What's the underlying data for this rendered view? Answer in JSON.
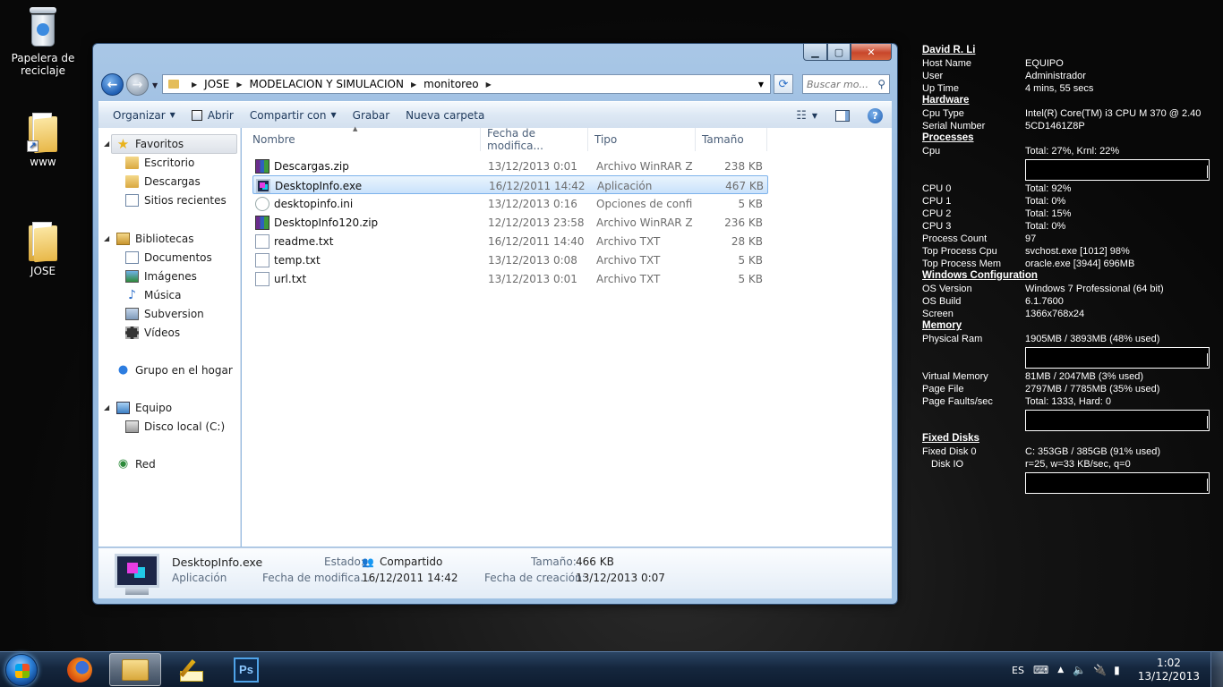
{
  "desktop": {
    "icons": [
      {
        "label": "Papelera de reciclaje",
        "icon": "recycle-bin-icon"
      },
      {
        "label": "www",
        "icon": "folder-shortcut-icon"
      },
      {
        "label": "JOSE",
        "icon": "folder-icon"
      }
    ]
  },
  "window": {
    "controls": {
      "minimize": "▁",
      "maximize": "▢",
      "close": "✕"
    },
    "breadcrumb": [
      "JOSE",
      "MODELACION Y SIMULACION",
      "monitoreo"
    ],
    "search_placeholder": "Buscar mo...",
    "toolbar": {
      "organize": "Organizar",
      "open": "Abrir",
      "share": "Compartir con",
      "burn": "Grabar",
      "new_folder": "Nueva carpeta"
    },
    "nav": {
      "favorites": "Favoritos",
      "desktop": "Escritorio",
      "downloads": "Descargas",
      "recent": "Sitios recientes",
      "libraries": "Bibliotecas",
      "documents": "Documentos",
      "images": "Imágenes",
      "music": "Música",
      "subversion": "Subversion",
      "videos": "Vídeos",
      "homegroup": "Grupo en el hogar",
      "computer": "Equipo",
      "local_disk": "Disco local (C:)",
      "network": "Red"
    },
    "columns": {
      "name": "Nombre",
      "date": "Fecha de modifica...",
      "type": "Tipo",
      "size": "Tamaño"
    },
    "files": [
      {
        "name": "Descargas.zip",
        "date": "13/12/2013 0:01",
        "type": "Archivo WinRAR Z...",
        "size": "238 KB",
        "icon": "zip"
      },
      {
        "name": "DesktopInfo.exe",
        "date": "16/12/2011 14:42",
        "type": "Aplicación",
        "size": "467 KB",
        "icon": "exe"
      },
      {
        "name": "desktopinfo.ini",
        "date": "13/12/2013 0:16",
        "type": "Opciones de confi...",
        "size": "5 KB",
        "icon": "ini"
      },
      {
        "name": "DesktopInfo120.zip",
        "date": "12/12/2013 23:58",
        "type": "Archivo WinRAR Z...",
        "size": "236 KB",
        "icon": "zip"
      },
      {
        "name": "readme.txt",
        "date": "16/12/2011 14:40",
        "type": "Archivo TXT",
        "size": "28 KB",
        "icon": "txt"
      },
      {
        "name": "temp.txt",
        "date": "13/12/2013 0:08",
        "type": "Archivo TXT",
        "size": "5 KB",
        "icon": "txt"
      },
      {
        "name": "url.txt",
        "date": "13/12/2013 0:01",
        "type": "Archivo TXT",
        "size": "5 KB",
        "icon": "txt"
      }
    ],
    "details": {
      "name": "DesktopInfo.exe",
      "kind": "Aplicación",
      "state_label": "Estado:",
      "state_value": "Compartido",
      "size_label": "Tamaño:",
      "size_value": "466 KB",
      "modified_label": "Fecha de modifica...",
      "modified_value": "16/12/2011 14:42",
      "created_label": "Fecha de creación:",
      "created_value": "13/12/2013 0:07"
    }
  },
  "desktopinfo": {
    "user_name": "David R. Li",
    "host_label": "Host Name",
    "host_value": "EQUIPO",
    "user_label": "User",
    "user_value": "Administrador",
    "uptime_label": "Up Time",
    "uptime_value": "4 mins, 55 secs",
    "hardware_header": "Hardware",
    "cpu_type_label": "Cpu Type",
    "cpu_type_value": "Intel(R) Core(TM) i3 CPU       M 370  @ 2.40",
    "serial_label": "Serial Number",
    "serial_value": "5CD1461Z8P",
    "processes_header": "Processes",
    "cpu_label": "Cpu",
    "cpu_value": "Total: 27%, Krnl: 22%",
    "cpu0_label": "CPU 0",
    "cpu0_value": "Total: 92%",
    "cpu1_label": "CPU 1",
    "cpu1_value": "Total: 0%",
    "cpu2_label": "CPU 2",
    "cpu2_value": "Total: 15%",
    "cpu3_label": "CPU 3",
    "cpu3_value": "Total: 0%",
    "pcount_label": "Process Count",
    "pcount_value": "97",
    "topcpu_label": "Top Process Cpu",
    "topcpu_value": "svchost.exe [1012] 98%",
    "topmem_label": "Top Process Mem",
    "topmem_value": "oracle.exe [3944] 696MB",
    "wincfg_header": "Windows Configuration",
    "osver_label": "OS Version",
    "osver_value": "Windows 7 Professional (64 bit)",
    "osbuild_label": "OS Build",
    "osbuild_value": "6.1.7600",
    "screen_label": "Screen",
    "screen_value": "1366x768x24",
    "memory_header": "Memory",
    "physram_label": "Physical Ram",
    "physram_value": "1905MB / 3893MB (48% used)",
    "virtmem_label": "Virtual Memory",
    "virtmem_value": "81MB / 2047MB (3% used)",
    "pagefile_label": "Page File",
    "pagefile_value": "2797MB / 7785MB (35% used)",
    "pagefaults_label": "Page Faults/sec",
    "pagefaults_value": "Total: 1333, Hard: 0",
    "disks_header": "Fixed Disks",
    "disk0_label": "Fixed Disk 0",
    "disk0_value": "C: 353GB / 385GB (91% used)",
    "diskio_label": "Disk IO",
    "diskio_value": "r=25, w=33 KB/sec, q=0"
  },
  "taskbar": {
    "apps": [
      "firefox-icon",
      "explorer-icon",
      "notepad-pencil-icon",
      "photoshop-icon"
    ],
    "ps_label": "Ps",
    "language": "ES",
    "time": "1:02",
    "date": "13/12/2013"
  }
}
